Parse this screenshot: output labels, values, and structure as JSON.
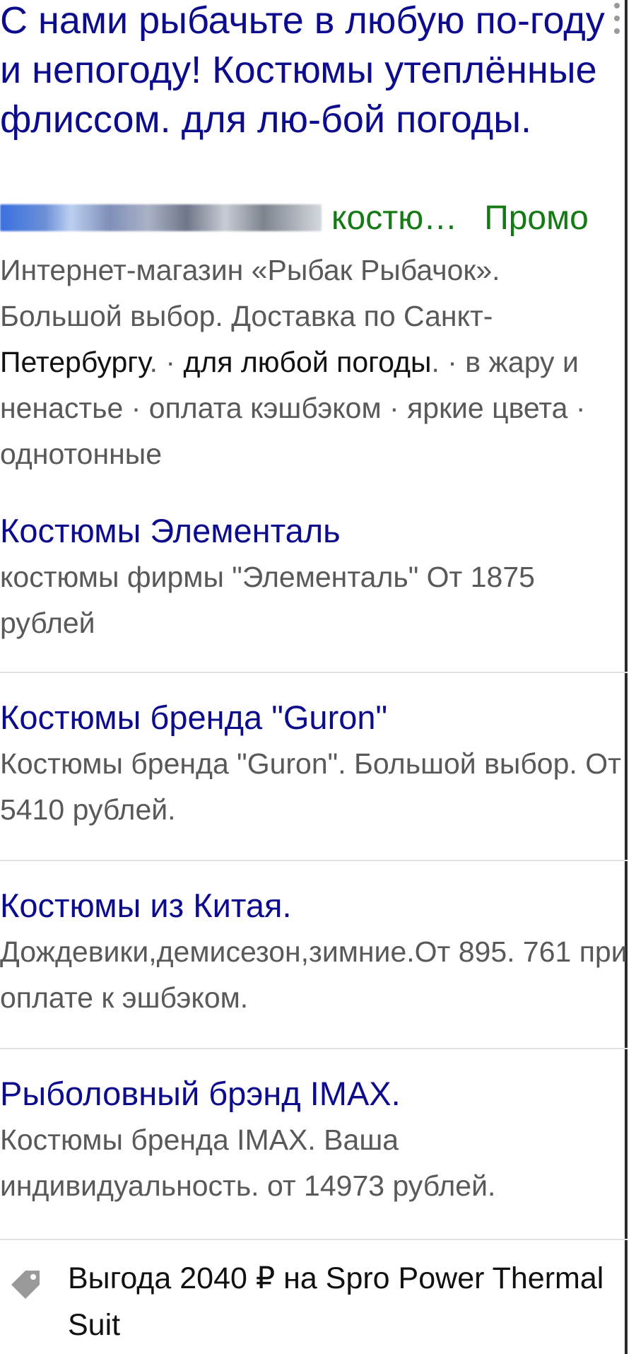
{
  "ad": {
    "title": "С нами рыбачьте в любую по-году и непогоду! Костюмы утеплённые флиссом. для лю-бой погоды.",
    "url_visible": "костю…",
    "promo_label": "Промо",
    "description": {
      "part1": "Интернет-магазин «Рыбак Рыбачок». Большой выбор. Доставка по Санкт-",
      "highlight1": "Петербургу",
      "part2": ". · ",
      "highlight2": "для любой погоды",
      "part3": ". · в жару и ненастье · оплата кэшбэком · яркие цвета · однотонные"
    }
  },
  "sitelinks": [
    {
      "title": "Костюмы Элементаль",
      "description": "костюмы фирмы \"Элементаль\" От 1875 рублей"
    },
    {
      "title": "Костюмы бренда \"Guron\"",
      "description": "Костюмы бренда \"Guron\". Большой выбор. От 5410 рублей."
    },
    {
      "title": "Костюмы из Китая.",
      "description": "Дождевики,демисезон,зимние.От 895. 761 при оплате к эшбэком."
    },
    {
      "title": "Рыболовный брэнд IMAX.",
      "description": "Костюмы бренда IMAX. Ваша индивидуальность. от 14973 рублей."
    }
  ],
  "offer": {
    "icon": "tag-icon",
    "text": "Выгода 2040 ₽ на Spro Power Thermal Suit"
  },
  "colors": {
    "title": "#0c0c8c",
    "url_green": "#157a15",
    "body_gray": "#595959",
    "divider": "#e2e2e2"
  }
}
